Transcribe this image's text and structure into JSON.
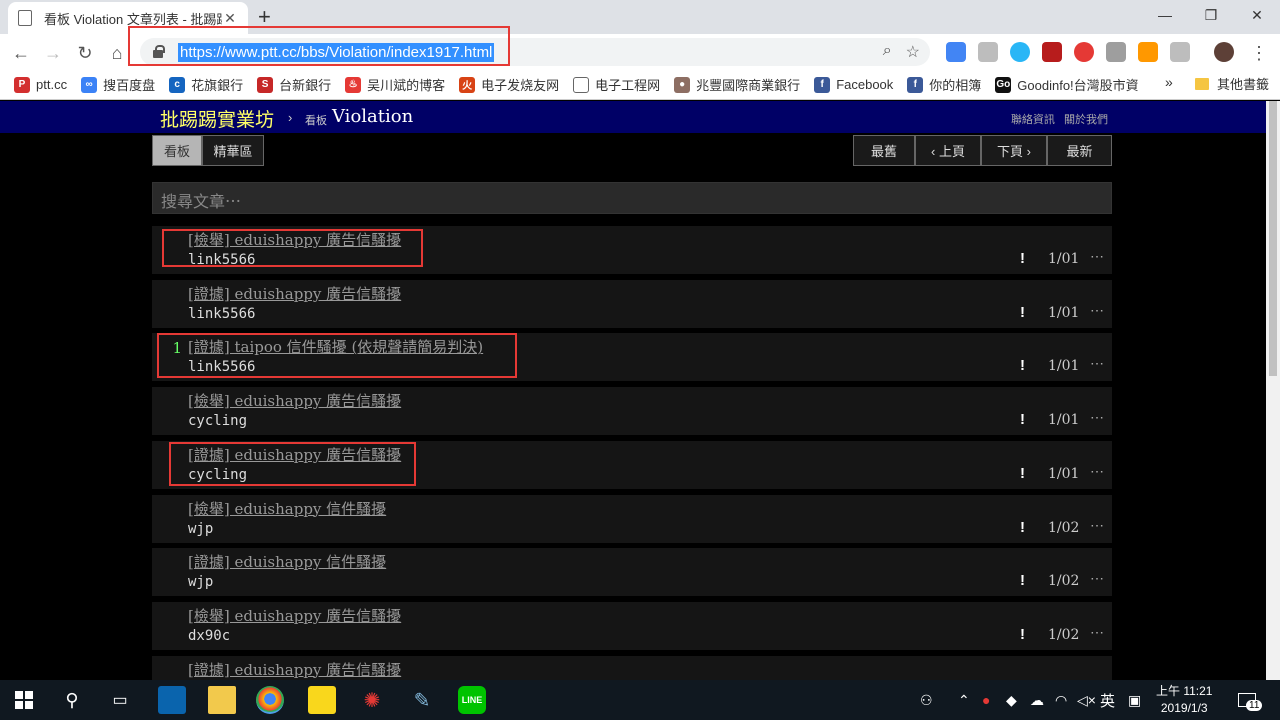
{
  "browser": {
    "tab_title": "看板 Violation 文章列表 - 批踢踢",
    "url": "https://www.ptt.cc/bbs/Violation/index1917.html",
    "bookmarks": [
      {
        "label": "ptt.cc",
        "color": "#d32f2f",
        "glyph": "P"
      },
      {
        "label": "搜百度盘",
        "color": "#3b82f6",
        "glyph": "∞"
      },
      {
        "label": "花旗銀行",
        "color": "#1565c0",
        "glyph": "c"
      },
      {
        "label": "台新銀行",
        "color": "#c62828",
        "glyph": "S"
      },
      {
        "label": "吴川斌的博客",
        "color": "#e53935",
        "glyph": "♨"
      },
      {
        "label": "电子发烧友网",
        "color": "#d84315",
        "glyph": "火"
      },
      {
        "label": "电子工程网",
        "color": "#ffffff",
        "glyph": ""
      },
      {
        "label": "兆豐國際商業銀行",
        "color": "#8d6e63",
        "glyph": "●"
      },
      {
        "label": "Facebook",
        "color": "#3b5998",
        "glyph": "f"
      },
      {
        "label": "你的相簿",
        "color": "#3b5998",
        "glyph": "f"
      },
      {
        "label": "Goodinfo!台灣股市資",
        "color": "#111111",
        "glyph": "Go"
      }
    ],
    "bookmarks_overflow": "»",
    "other_bookmarks": "其他書籤"
  },
  "ptt": {
    "brand": "批踢踢實業坊",
    "arrow": "›",
    "board_tag": "看板",
    "board_name": "Violation",
    "links": [
      "聯絡資訊",
      "關於我們"
    ],
    "tabs": [
      "看板",
      "精華區"
    ],
    "paging": [
      "最舊",
      "‹ 上頁",
      "下頁 ›",
      "最新"
    ],
    "search_placeholder": "搜尋文章⋯",
    "entries": [
      {
        "nrec": "",
        "title": "[檢舉] eduishappy 廣告信騷擾",
        "author": "link5566",
        "mark": "!",
        "date": "1/01",
        "more": "⋯"
      },
      {
        "nrec": "",
        "title": "[證據] eduishappy 廣告信騷擾",
        "author": "link5566",
        "mark": "!",
        "date": "1/01",
        "more": "⋯"
      },
      {
        "nrec": "1",
        "title": "[證據] taipoo 信件騷擾 (依規聲請簡易判決)",
        "author": "link5566",
        "mark": "!",
        "date": "1/01",
        "more": "⋯"
      },
      {
        "nrec": "",
        "title": "[檢舉] eduishappy 廣告信騷擾",
        "author": "cycling",
        "mark": "!",
        "date": "1/01",
        "more": "⋯"
      },
      {
        "nrec": "",
        "title": "[證據] eduishappy 廣告信騷擾",
        "author": "cycling",
        "mark": "!",
        "date": "1/01",
        "more": "⋯"
      },
      {
        "nrec": "",
        "title": "[檢舉] eduishappy 信件騷擾",
        "author": "wjp",
        "mark": "!",
        "date": "1/02",
        "more": "⋯"
      },
      {
        "nrec": "",
        "title": "[證據] eduishappy 信件騷擾",
        "author": "wjp",
        "mark": "!",
        "date": "1/02",
        "more": "⋯"
      },
      {
        "nrec": "",
        "title": "[檢舉] eduishappy 廣告信騷擾",
        "author": "dx90c",
        "mark": "!",
        "date": "1/02",
        "more": "⋯"
      },
      {
        "nrec": "",
        "title": "[證據] eduishappy 廣告信騷擾",
        "author": "",
        "mark": "",
        "date": "",
        "more": ""
      }
    ]
  },
  "taskbar": {
    "ime": "英",
    "time": "上午 11:21",
    "date": "2019/1/3",
    "notifications": "11"
  }
}
